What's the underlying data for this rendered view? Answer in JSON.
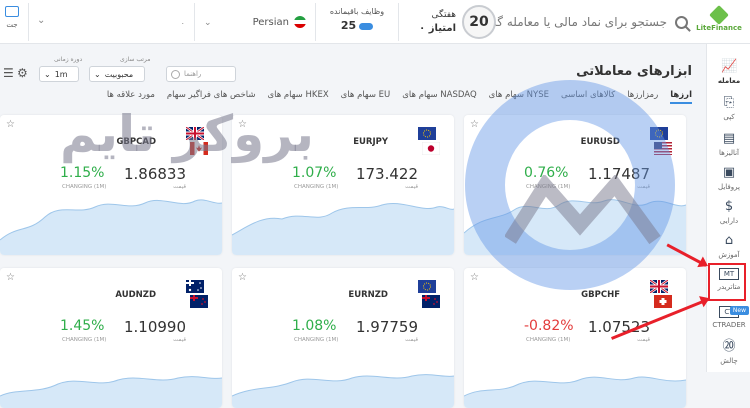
{
  "header": {
    "search_placeholder": "جستجو برای نماد مالی یا معامله گر",
    "logo_text": "LiteFinance",
    "level": {
      "number": "20",
      "label1": "هفتگی",
      "label2": "امتیاز ۰"
    },
    "tasks": {
      "label": "وظایف باقیمانده",
      "count": "25"
    },
    "language": "Persian",
    "account_value": "",
    "account_dot": ".",
    "wallet_label": "جت"
  },
  "sidebar": {
    "items": [
      {
        "label": "معامله",
        "icon": "chart-icon",
        "glyph": "📈",
        "active": true
      },
      {
        "label": "کپی",
        "icon": "copy-icon",
        "glyph": "⎘"
      },
      {
        "label": "آنالیزها",
        "icon": "analysis-icon",
        "glyph": "📋"
      },
      {
        "label": "پروفایل",
        "icon": "profile-icon",
        "glyph": "▣"
      },
      {
        "label": "دارایی",
        "icon": "dollar-icon",
        "glyph": "$"
      },
      {
        "label": "آموزش",
        "icon": "education-icon",
        "glyph": "🎓"
      },
      {
        "label": "متاتریدر",
        "icon": "mt-icon",
        "glyph": "MT"
      },
      {
        "label": "CTRADER",
        "icon": "ct-icon",
        "glyph": "CT",
        "badge": "New"
      },
      {
        "label": "چالش",
        "icon": "challenge-icon",
        "glyph": "20"
      }
    ]
  },
  "page": {
    "title": "ابزارهای معاملاتی",
    "tabs": [
      "ارزها",
      "رمزارزها",
      "کالاهای اساسی",
      "سهام های NYSE",
      "سهام های NASDAQ",
      "سهام های EU",
      "سهام های HKEX",
      "شاخص های فراگیر سهام",
      "مورد علاقه ها"
    ],
    "filters": {
      "search_placeholder": "راهنما",
      "sort_label": "مرتب سازی",
      "sort_value": "محبوبیت",
      "period_label": "دوره زمانی",
      "period_value": "1m"
    },
    "watermark": "بروکر تایم"
  },
  "cards": [
    {
      "symbol": "EURUSD",
      "price": "1.17487",
      "price_label": "قیمت",
      "change": "0.76%",
      "change_label": "CHANGING (1M)",
      "direction": "up",
      "flag_a": "eu",
      "flag_b": "us"
    },
    {
      "symbol": "EURJPY",
      "price": "173.422",
      "price_label": "قیمت",
      "change": "1.07%",
      "change_label": "CHANGING (1M)",
      "direction": "up",
      "flag_a": "eu",
      "flag_b": "jp"
    },
    {
      "symbol": "GBPCAD",
      "price": "1.86833",
      "price_label": "قیمت",
      "change": "1.15%",
      "change_label": "CHANGING (1M)",
      "direction": "up",
      "flag_a": "gb",
      "flag_b": "ca"
    },
    {
      "symbol": "GBPCHF",
      "price": "1.07523",
      "price_label": "قیمت",
      "change": "-0.82%",
      "change_label": "CHANGING (1M)",
      "direction": "down",
      "flag_a": "gb",
      "flag_b": "ch"
    },
    {
      "symbol": "EURNZD",
      "price": "1.97759",
      "price_label": "قیمت",
      "change": "1.08%",
      "change_label": "CHANGING (1M)",
      "direction": "up",
      "flag_a": "eu",
      "flag_b": "nz"
    },
    {
      "symbol": "AUDNZD",
      "price": "1.10990",
      "price_label": "قیمت",
      "change": "1.45%",
      "change_label": "CHANGING (1M)",
      "direction": "up",
      "flag_a": "au",
      "flag_b": "nz"
    }
  ],
  "colors": {
    "positive": "#2fae4a",
    "negative": "#e33b3b",
    "accent": "#3a8de0",
    "highlight": "#e8202a"
  }
}
